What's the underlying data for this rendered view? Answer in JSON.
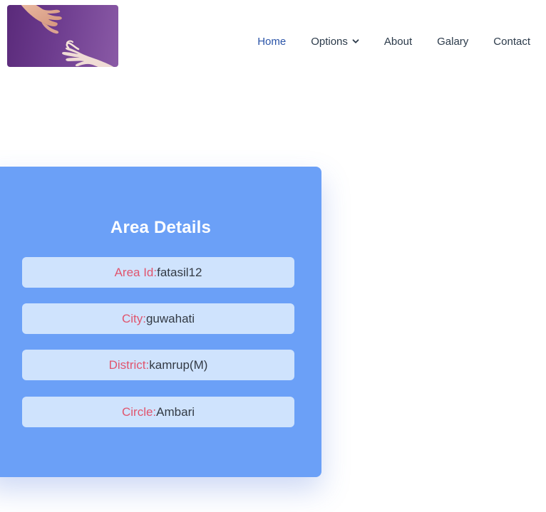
{
  "logo": {
    "icon": "hands-reaching-icon"
  },
  "nav": {
    "items": [
      {
        "label": "Home",
        "active": true
      },
      {
        "label": "Options",
        "has_dropdown": true
      },
      {
        "label": "About"
      },
      {
        "label": "Galary"
      },
      {
        "label": "Contact"
      }
    ]
  },
  "card": {
    "title": "Area Details",
    "rows": [
      {
        "label": "Area Id:",
        "value": "fatasil12"
      },
      {
        "label": "City:",
        "value": "guwahati"
      },
      {
        "label": "District:",
        "value": "kamrup(M)"
      },
      {
        "label": "Circle:",
        "value": "Ambari"
      }
    ]
  },
  "colors": {
    "card_bg": "#6ba0f7",
    "row_bg": "#cfe3fd",
    "label": "#e0556e",
    "nav_active": "#2a54a8"
  }
}
